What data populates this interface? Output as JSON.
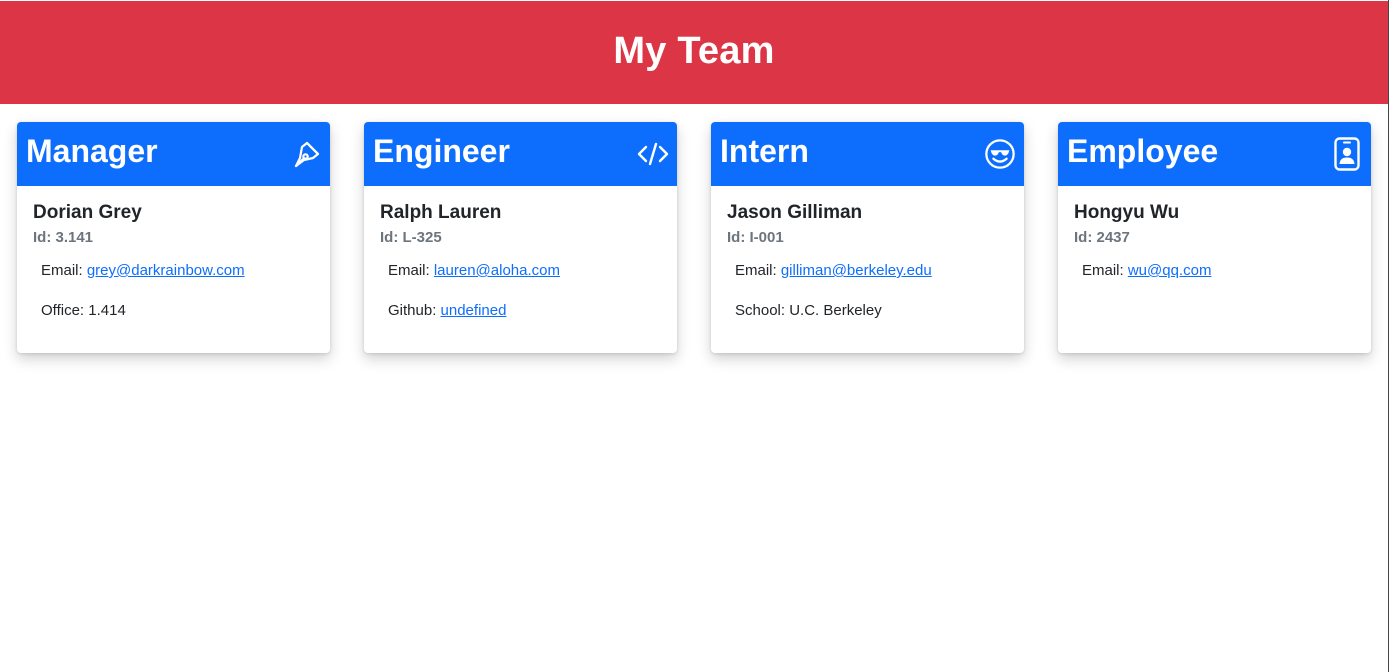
{
  "header": {
    "title": "My Team"
  },
  "colors": {
    "header_bg": "#dc3545",
    "card_head_bg": "#0d6efd",
    "link": "#0d6efd"
  },
  "cards": [
    {
      "role": "Manager",
      "icon": "pen-icon",
      "name": "Dorian Grey",
      "id": "Id: 3.141",
      "email_label": "Email: ",
      "email": "grey@darkrainbow.com",
      "extra_label": "Office: ",
      "extra_value": "1.414"
    },
    {
      "role": "Engineer",
      "icon": "code-icon",
      "name": "Ralph Lauren",
      "id": "Id: L-325",
      "email_label": "Email: ",
      "email": "lauren@aloha.com",
      "extra_label": "Github: ",
      "extra_value": "undefined"
    },
    {
      "role": "Intern",
      "icon": "sunglasses-smiley-icon",
      "name": "Jason Gilliman",
      "id": "Id: I-001",
      "email_label": "Email: ",
      "email": "gilliman@berkeley.edu",
      "extra_label": "School: ",
      "extra_value": "U.C. Berkeley"
    },
    {
      "role": "Employee",
      "icon": "badge-icon",
      "name": "Hongyu Wu",
      "id": "Id: 2437",
      "email_label": "Email: ",
      "email": "wu@qq.com"
    }
  ]
}
